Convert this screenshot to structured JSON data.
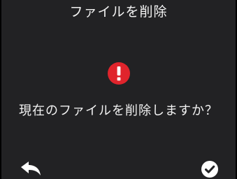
{
  "dialog": {
    "title": "ファイルを削除",
    "message": "現在のファイルを削除しますか？",
    "icon": "exclamation-circle-icon",
    "icon_color": "#e0242c",
    "background_color": "#222224"
  },
  "actions": {
    "back_icon": "reply-arrow-icon",
    "confirm_icon": "check-circle-icon"
  }
}
